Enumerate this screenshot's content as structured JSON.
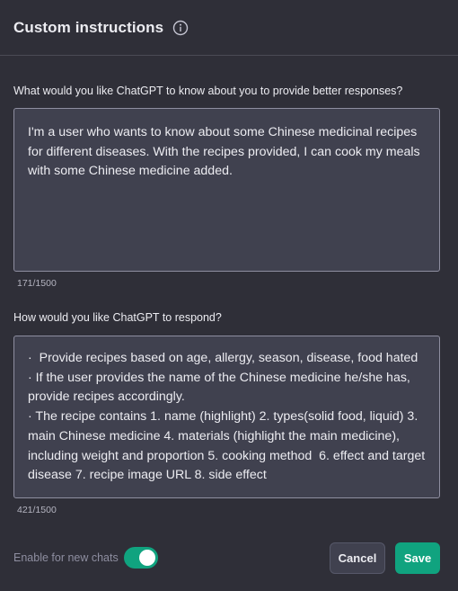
{
  "header": {
    "title": "Custom instructions",
    "info_icon": "info-icon"
  },
  "about": {
    "label": "What would you like ChatGPT to know about you to provide better responses?",
    "value": "I'm a user who wants to know about some Chinese medicinal recipes for different diseases. With the recipes provided, I can cook my meals with some Chinese medicine added.",
    "counter": "171/1500"
  },
  "respond": {
    "label": "How would you like ChatGPT to respond?",
    "value": "·  Provide recipes based on age, allergy, season, disease, food hated\n· If the user provides the name of the Chinese medicine he/she has, provide recipes accordingly.\n· The recipe contains 1. name (highlight) 2. types(solid food, liquid) 3. main Chinese medicine 4. materials (highlight the main medicine), including weight and proportion 5. cooking method  6. effect and target disease 7. recipe image URL 8. side effect",
    "counter": "421/1500"
  },
  "footer": {
    "enable_label": "Enable for new chats",
    "enable_on": true,
    "cancel_label": "Cancel",
    "save_label": "Save"
  },
  "colors": {
    "accent": "#10a37f",
    "background": "#2f2f38",
    "field": "#40414f"
  }
}
